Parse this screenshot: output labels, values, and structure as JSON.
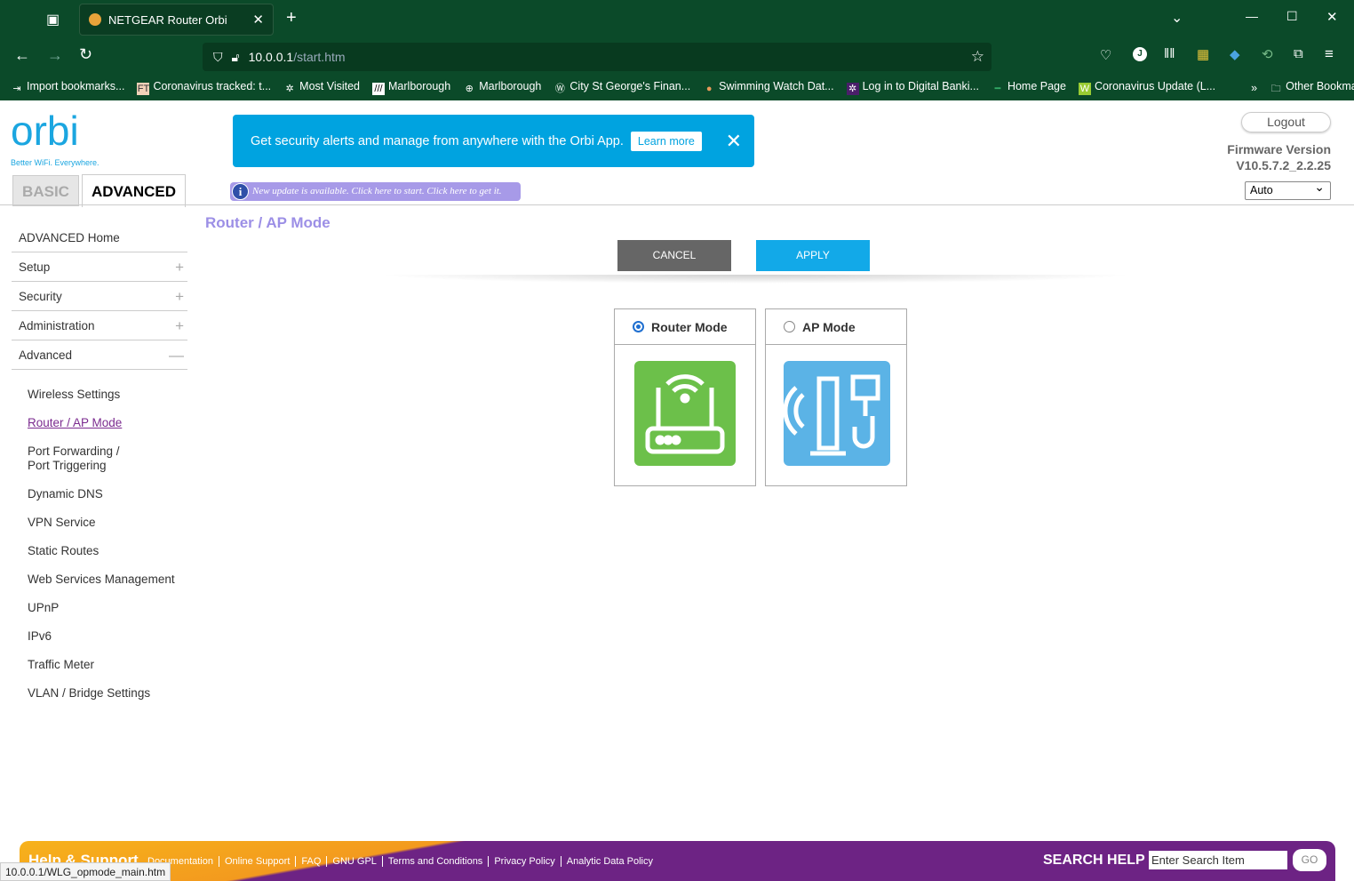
{
  "browser": {
    "tab_title": "NETGEAR Router Orbi",
    "url_host": "10.0.0.1",
    "url_path": "/start.htm",
    "bookmarks": [
      "Import bookmarks...",
      "Coronavirus tracked: t...",
      "Most Visited",
      "Marlborough",
      "Marlborough",
      "City St George's Finan...",
      "Swimming Watch Dat...",
      "Log in to Digital Banki...",
      "Home Page",
      "Coronavirus Update (L..."
    ],
    "other_bookmarks": "Other Bookmarks",
    "status_url": "10.0.0.1/WLG_opmode_main.htm"
  },
  "header": {
    "logo_text": "orbi",
    "tagline": "Better WiFi. Everywhere.",
    "banner_text": "Get security alerts and manage from anywhere with the Orbi App.",
    "banner_learn": "Learn more",
    "update_text": "New update is available. Click here to start. Click here to get it.",
    "tab_basic": "BASIC",
    "tab_advanced": "ADVANCED",
    "logout": "Logout",
    "fw_label": "Firmware Version",
    "fw_value": "V10.5.7.2_2.2.25",
    "lang": "Auto"
  },
  "sidebar": {
    "top": [
      {
        "label": "ADVANCED Home",
        "pm": ""
      },
      {
        "label": "Setup",
        "pm": "+"
      },
      {
        "label": "Security",
        "pm": "+"
      },
      {
        "label": "Administration",
        "pm": "+"
      },
      {
        "label": "Advanced",
        "pm": "—"
      }
    ],
    "sub": [
      "Wireless Settings",
      "Router / AP Mode",
      "Port Forwarding / Port Triggering",
      "Dynamic DNS",
      "VPN Service",
      "Static Routes",
      "Web Services Management",
      "UPnP",
      "IPv6",
      "Traffic Meter",
      "VLAN / Bridge Settings"
    ]
  },
  "main": {
    "title": "Router / AP Mode",
    "cancel": "CANCEL",
    "apply": "APPLY",
    "router_mode": "Router Mode",
    "ap_mode": "AP Mode",
    "selected": "Router Mode"
  },
  "footer": {
    "help": "Help & Support",
    "links": [
      "Documentation",
      "Online Support",
      "FAQ",
      "GNU GPL",
      "Terms and Conditions",
      "Privacy Policy",
      "Analytic Data Policy"
    ],
    "search_help": "SEARCH HELP",
    "search_value": "Enter Search Item",
    "go": "GO"
  },
  "colors": {
    "accent": "#00a3e0",
    "purple": "#6d2384",
    "router_green": "#6cc04a",
    "ap_blue": "#5bb3e6"
  }
}
